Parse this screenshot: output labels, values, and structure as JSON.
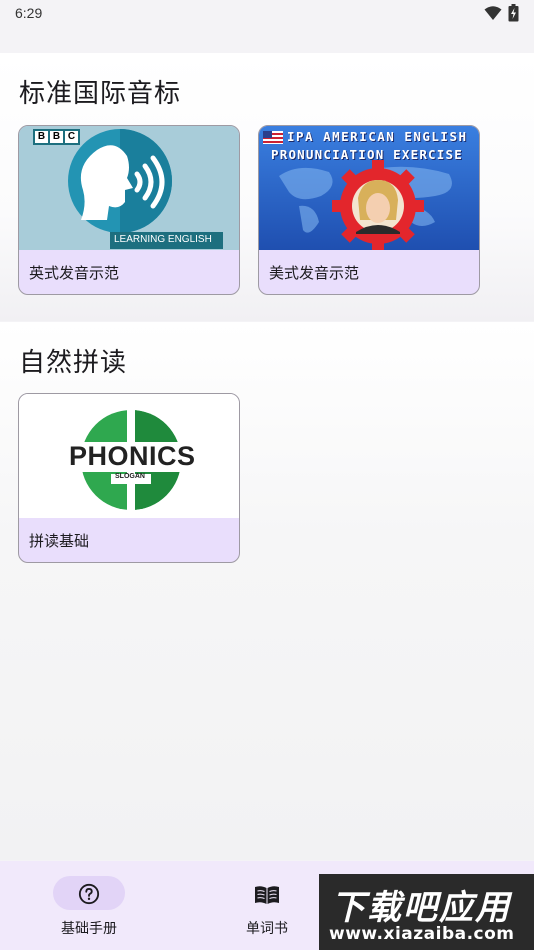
{
  "status_bar": {
    "time": "6:29"
  },
  "sections": [
    {
      "title": "标准国际音标",
      "cards": [
        {
          "label": "英式发音示范",
          "badge": "BBC",
          "thumb_caption": "LEARNING ENGLISH"
        },
        {
          "label": "美式发音示范",
          "thumb_title_line1": "IPA AMERICAN ENGLISH",
          "thumb_title_line2": "PRONUNCIATION EXERCISE"
        }
      ]
    },
    {
      "title": "自然拼读",
      "cards": [
        {
          "label": "拼读基础",
          "logo_text": "PHONICS",
          "logo_sub": "SLOGAN"
        }
      ]
    }
  ],
  "bottom_nav": {
    "items": [
      {
        "label": "基础手册",
        "icon": "help-circle-icon",
        "active": true
      },
      {
        "label": "单词书",
        "icon": "book-icon",
        "active": false
      }
    ]
  },
  "watermark": {
    "main": "下载吧应用",
    "url": "www.xiazaiba.com"
  },
  "colors": {
    "card_bg": "#e9defc",
    "nav_bg": "#f1e9fb",
    "nav_active": "#e2d4f7",
    "bbc_teal": "#1a9ab8",
    "phonics_green": "#2fa84f"
  }
}
